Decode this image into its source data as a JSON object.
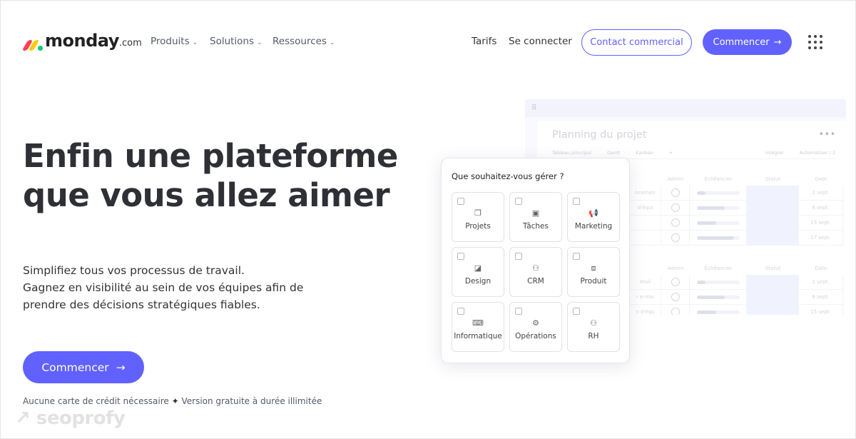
{
  "brand": {
    "name": "monday",
    "suffix": ".com",
    "colors": [
      "#ff3d57",
      "#ffcb00",
      "#00ca72"
    ],
    "accent": "#6161ff"
  },
  "nav": {
    "items": [
      {
        "label": "Produits"
      },
      {
        "label": "Solutions"
      },
      {
        "label": "Ressources"
      }
    ],
    "pricing": "Tarifs",
    "login": "Se connecter",
    "contact": "Contact commercial",
    "start": "Commencer"
  },
  "hero": {
    "title_line1": "Enfin une plateforme",
    "title_line2": "que vous allez aimer",
    "sub1": "Simplifiez tous vos processus de travail.",
    "sub2": "Gagnez en visibilité au sein de vos équipes afin de",
    "sub3": "prendre des décisions stratégiques fiables.",
    "cta": "Commencer",
    "note1": "Aucune carte de crédit nécessaire",
    "note_sep": "✦",
    "note2": "Version gratuite à durée illimitée"
  },
  "board": {
    "title": "Planning du projet",
    "tabs": [
      "Tableau principal",
      "Gantt",
      "Kanban",
      "+"
    ],
    "right_tabs": [
      "Intégrer",
      "Automatiser / 2"
    ],
    "columns": [
      "",
      "Admin",
      "Échéancier",
      "Statut",
      "Date",
      "+"
    ],
    "group1": [
      {
        "name": "ncemen",
        "progress": 20,
        "date": "2 sept."
      },
      {
        "name": "d'équi",
        "progress": 65,
        "date": "6 sept."
      },
      {
        "name": "",
        "progress": 45,
        "date": "15 sept."
      },
      {
        "name": "",
        "progress": 88,
        "date": "17 sept."
      }
    ],
    "group2": [
      {
        "name": "étail",
        "progress": 20,
        "date": "2 sept."
      },
      {
        "name": "r e-mai",
        "progress": 65,
        "date": "6 sept."
      },
      {
        "name": "n d'équ",
        "progress": 45,
        "date": "15 sept."
      }
    ]
  },
  "picker": {
    "title": "Que souhaitez-vous gérer ?",
    "options": [
      {
        "label": "Projets",
        "icon": "projects-icon",
        "glyph": "❐"
      },
      {
        "label": "Tâches",
        "icon": "tasks-icon",
        "glyph": "▣"
      },
      {
        "label": "Marketing",
        "icon": "megaphone-icon",
        "glyph": "📢"
      },
      {
        "label": "Design",
        "icon": "design-icon",
        "glyph": "◪"
      },
      {
        "label": "CRM",
        "icon": "crm-icon",
        "glyph": "⚇"
      },
      {
        "label": "Produit",
        "icon": "product-icon",
        "glyph": "⧈"
      },
      {
        "label": "Informatique",
        "icon": "laptop-icon",
        "glyph": "⌨"
      },
      {
        "label": "Opérations",
        "icon": "gear-icon",
        "glyph": "⚙"
      },
      {
        "label": "RH",
        "icon": "people-icon",
        "glyph": "⚇"
      }
    ]
  },
  "watermark": "seoprofy"
}
